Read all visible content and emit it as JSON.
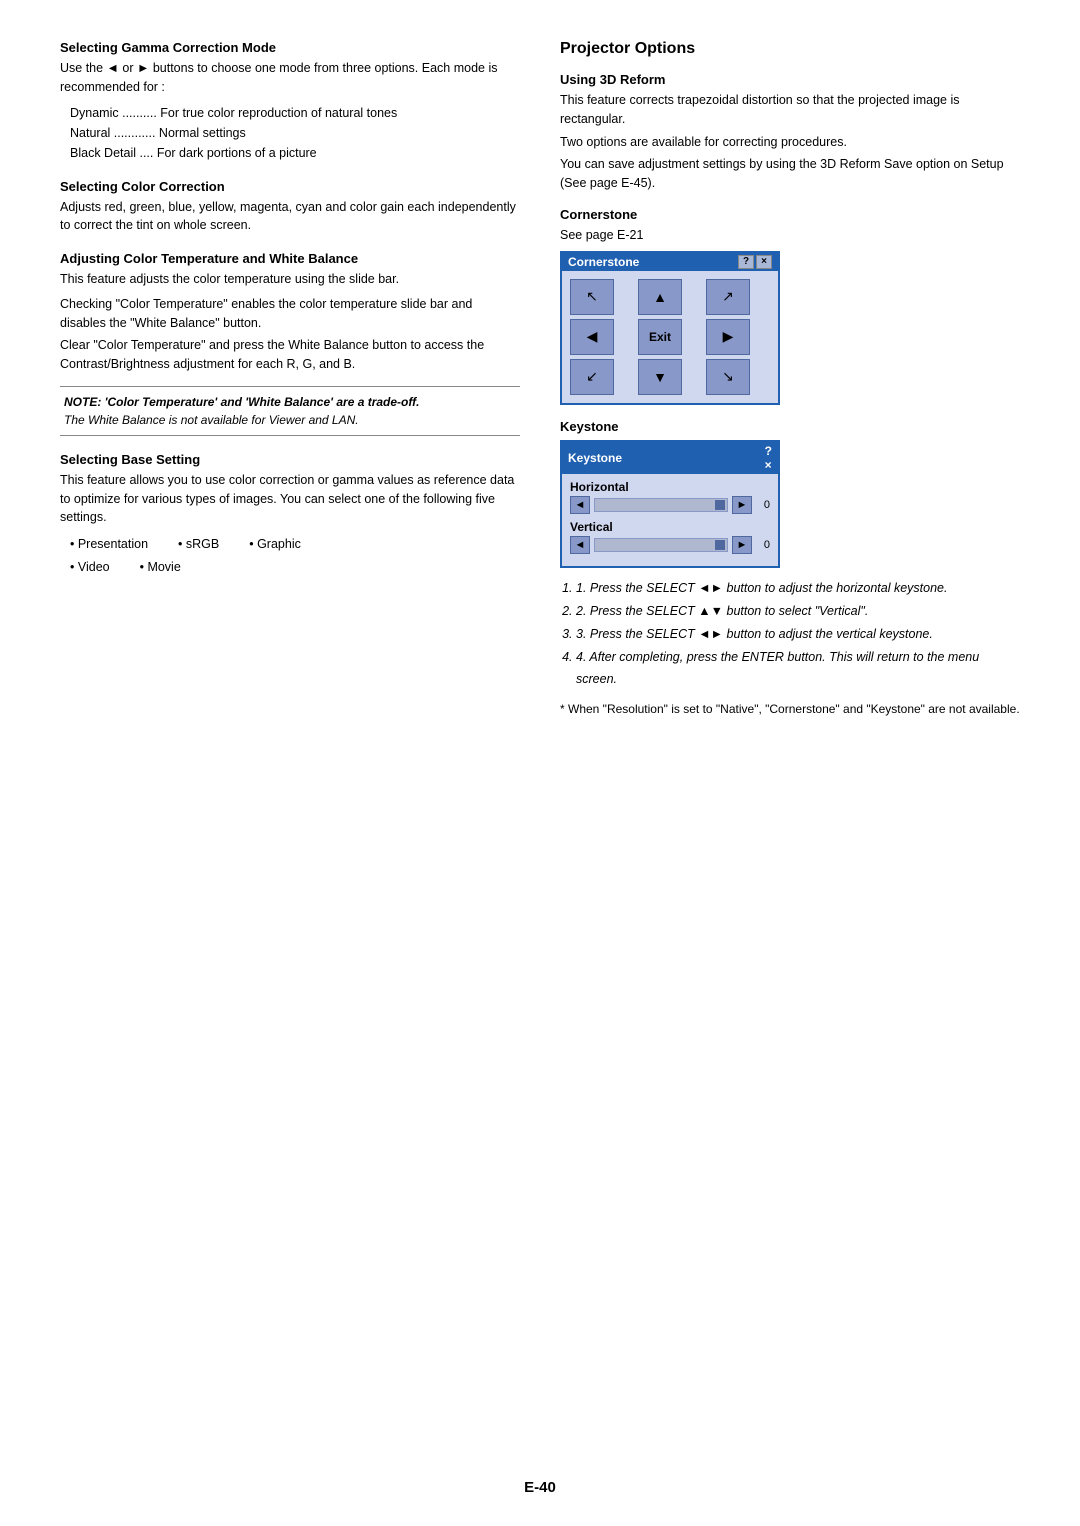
{
  "left_col": {
    "sections": [
      {
        "id": "gamma",
        "title": "Selecting Gamma Correction Mode",
        "paragraphs": [
          "Use the ◄ or ► buttons to choose one mode from three options. Each mode is recommended for :",
          ""
        ],
        "indent_items": [
          "Dynamic .......... For true color reproduction of natural tones",
          "Natural ............ Normal settings",
          "Black Detail .... For dark portions of a picture"
        ]
      },
      {
        "id": "color-correction",
        "title": "Selecting Color Correction",
        "paragraphs": [
          "Adjusts red, green, blue, yellow, magenta, cyan and color gain each independently to correct the tint on whole screen."
        ]
      },
      {
        "id": "color-temp",
        "title": "Adjusting Color Temperature and White Balance",
        "paragraphs": [
          "This feature adjusts the color temperature using the slide bar.",
          "",
          "Checking \"Color Temperature\" enables the color temperature slide bar and disables the \"White Balance\" button.",
          "Clear \"Color Temperature\" and press the White Balance button to access the Contrast/Brightness adjustment for each R, G, and B."
        ]
      },
      {
        "id": "note",
        "bold_text": "NOTE: 'Color Temperature' and 'White Balance' are a trade-off.",
        "italic_text": "The White Balance is not available for Viewer and LAN."
      },
      {
        "id": "base-setting",
        "title": "Selecting Base Setting",
        "paragraphs": [
          "This feature allows you to use color correction or gamma values as reference data to optimize for various types of images. You can select one of the following five settings."
        ],
        "bullets": [
          [
            "• Presentation",
            "• sRGB",
            "• Graphic"
          ],
          [
            "• Video",
            "• Movie"
          ]
        ]
      }
    ]
  },
  "right_col": {
    "main_title": "Projector Options",
    "sections": [
      {
        "id": "3d-reform",
        "title": "Using 3D Reform",
        "paragraphs": [
          "This feature corrects trapezoidal distortion so that the projected image is rectangular.",
          "Two options are available for correcting procedures.",
          "You can save adjustment settings by using the 3D Reform Save option on Setup (See page E-45)."
        ]
      },
      {
        "id": "cornerstone",
        "title": "Cornerstone",
        "sub_text": "See page E-21",
        "dialog": {
          "title": "Cornerstone",
          "controls": [
            "?",
            "×"
          ],
          "buttons": [
            [
              "↖",
              "▲",
              "↗"
            ],
            [
              "◄",
              "Exit",
              "►"
            ],
            [
              "↙",
              "▼",
              "↘"
            ]
          ]
        }
      },
      {
        "id": "keystone",
        "title": "Keystone",
        "dialog": {
          "title": "Keystone",
          "controls": [
            "?",
            "×"
          ],
          "horizontal_label": "Horizontal",
          "vertical_label": "Vertical",
          "h_value": "0",
          "v_value": "0"
        }
      }
    ],
    "instructions": [
      "1.  Press the SELECT ◄► button to adjust the horizontal keystone.",
      "2.  Press the SELECT ▲▼ button to select \"Vertical\".",
      "3.  Press the SELECT ◄► button to adjust the vertical keystone.",
      "4.  After completing, press the ENTER button. This will return to the menu screen."
    ],
    "footnote": "* When \"Resolution\" is set to \"Native\", \"Cornerstone\" and \"Keystone\" are not available."
  },
  "page_number": "E-40"
}
